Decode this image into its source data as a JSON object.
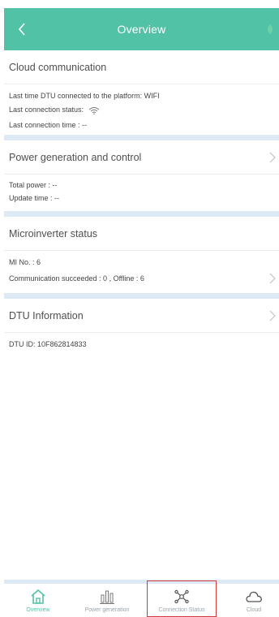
{
  "header": {
    "title": "Overview",
    "back_icon": "chevron-left-icon",
    "accent": "#52c2a6"
  },
  "cloud": {
    "title": "Cloud communication",
    "connected_via": "Last time DTU connected to the platform: WIFI",
    "status_label": "Last connection status:",
    "status_icon": "wifi-icon",
    "time": "Last connection time : --"
  },
  "power": {
    "title": "Power generation and control",
    "total": "Total power : --",
    "update": "Update time : --"
  },
  "micro": {
    "title": "Microinverter status",
    "mi_no": "MI No. : 6",
    "comm": "Communication succeeded : 0 ,  Offline : 6"
  },
  "dtu": {
    "title": "DTU Information",
    "id": "DTU ID: 10F862814833"
  },
  "tabs": [
    {
      "label": "Overview",
      "icon": "home-icon",
      "active": true
    },
    {
      "label": "Power generation",
      "icon": "bar-chart-icon",
      "active": false
    },
    {
      "label": "Connection Status",
      "icon": "network-icon",
      "active": false
    },
    {
      "label": "Cloud",
      "icon": "cloud-icon",
      "active": false
    }
  ],
  "colors": {
    "section_gap": "#dde9f4",
    "highlight_border": "#d23b3b"
  }
}
